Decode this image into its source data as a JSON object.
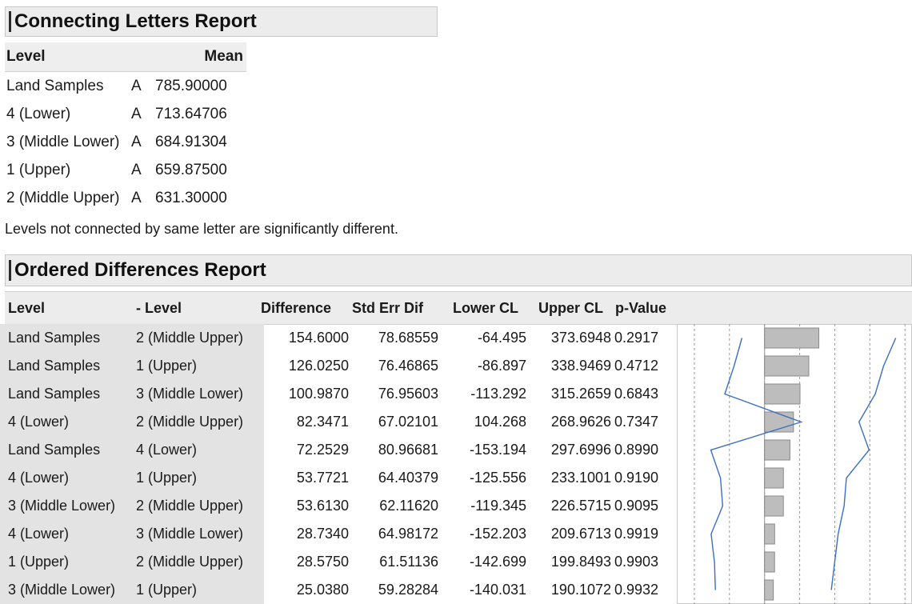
{
  "connecting_letters": {
    "title": "Connecting Letters Report",
    "header_level": "Level",
    "header_mean": "Mean",
    "rows": [
      {
        "level": "Land Samples",
        "letter": "A",
        "mean": "785.90000"
      },
      {
        "level": "4 (Lower)",
        "letter": "A",
        "mean": "713.64706"
      },
      {
        "level": "3 (Middle Lower)",
        "letter": "A",
        "mean": "684.91304"
      },
      {
        "level": "1 (Upper)",
        "letter": "A",
        "mean": "659.87500"
      },
      {
        "level": "2 (Middle Upper)",
        "letter": "A",
        "mean": "631.30000"
      }
    ],
    "note": "Levels not connected by same letter are significantly different."
  },
  "ordered_differences": {
    "title": "Ordered Differences Report",
    "headers": {
      "level": "Level",
      "minus_level": "- Level",
      "difference": "Difference",
      "std_err_dif": "Std Err Dif",
      "lower_cl": "Lower CL",
      "upper_cl": "Upper CL",
      "p_value": "p-Value"
    },
    "rows": [
      {
        "level": "Land Samples",
        "minus_level": "2 (Middle Upper)",
        "difference": "154.6000",
        "std_err_dif": "78.68559",
        "lower_cl": "-64.495",
        "upper_cl": "373.6948",
        "p_value": "0.2917"
      },
      {
        "level": "Land Samples",
        "minus_level": "1 (Upper)",
        "difference": "126.0250",
        "std_err_dif": "76.46865",
        "lower_cl": "-86.897",
        "upper_cl": "338.9469",
        "p_value": "0.4712"
      },
      {
        "level": "Land Samples",
        "minus_level": "3 (Middle Lower)",
        "difference": "100.9870",
        "std_err_dif": "76.95603",
        "lower_cl": "-113.292",
        "upper_cl": "315.2659",
        "p_value": "0.6843"
      },
      {
        "level": "4 (Lower)",
        "minus_level": "2 (Middle Upper)",
        "difference": "82.3471",
        "std_err_dif": "67.02101",
        "lower_cl": "104.268",
        "upper_cl": "268.9626",
        "p_value": "0.7347"
      },
      {
        "level": "Land Samples",
        "minus_level": "4 (Lower)",
        "difference": "72.2529",
        "std_err_dif": "80.96681",
        "lower_cl": "-153.194",
        "upper_cl": "297.6996",
        "p_value": "0.8990"
      },
      {
        "level": "4 (Lower)",
        "minus_level": "1 (Upper)",
        "difference": "53.7721",
        "std_err_dif": "64.40379",
        "lower_cl": "-125.556",
        "upper_cl": "233.1001",
        "p_value": "0.9190"
      },
      {
        "level": "3 (Middle Lower)",
        "minus_level": "2 (Middle Upper)",
        "difference": "53.6130",
        "std_err_dif": "62.11620",
        "lower_cl": "-119.345",
        "upper_cl": "226.5715",
        "p_value": "0.9095"
      },
      {
        "level": "4 (Lower)",
        "minus_level": "3 (Middle Lower)",
        "difference": "28.7340",
        "std_err_dif": "64.98172",
        "lower_cl": "-152.203",
        "upper_cl": "209.6713",
        "p_value": "0.9919"
      },
      {
        "level": "1 (Upper)",
        "minus_level": "2 (Middle Upper)",
        "difference": "28.5750",
        "std_err_dif": "61.51136",
        "lower_cl": "-142.699",
        "upper_cl": "199.8493",
        "p_value": "0.9903"
      },
      {
        "level": "3 (Middle Lower)",
        "minus_level": "1 (Upper)",
        "difference": "25.0380",
        "std_err_dif": "59.28284",
        "lower_cl": "-140.031",
        "upper_cl": "190.1072",
        "p_value": "0.9932"
      }
    ]
  },
  "colors": {
    "header_bg": "#ececec",
    "bar_fill": "#bdbdbd",
    "ci_line": "#3a6fc4",
    "grid": "#9a9a9a"
  }
}
